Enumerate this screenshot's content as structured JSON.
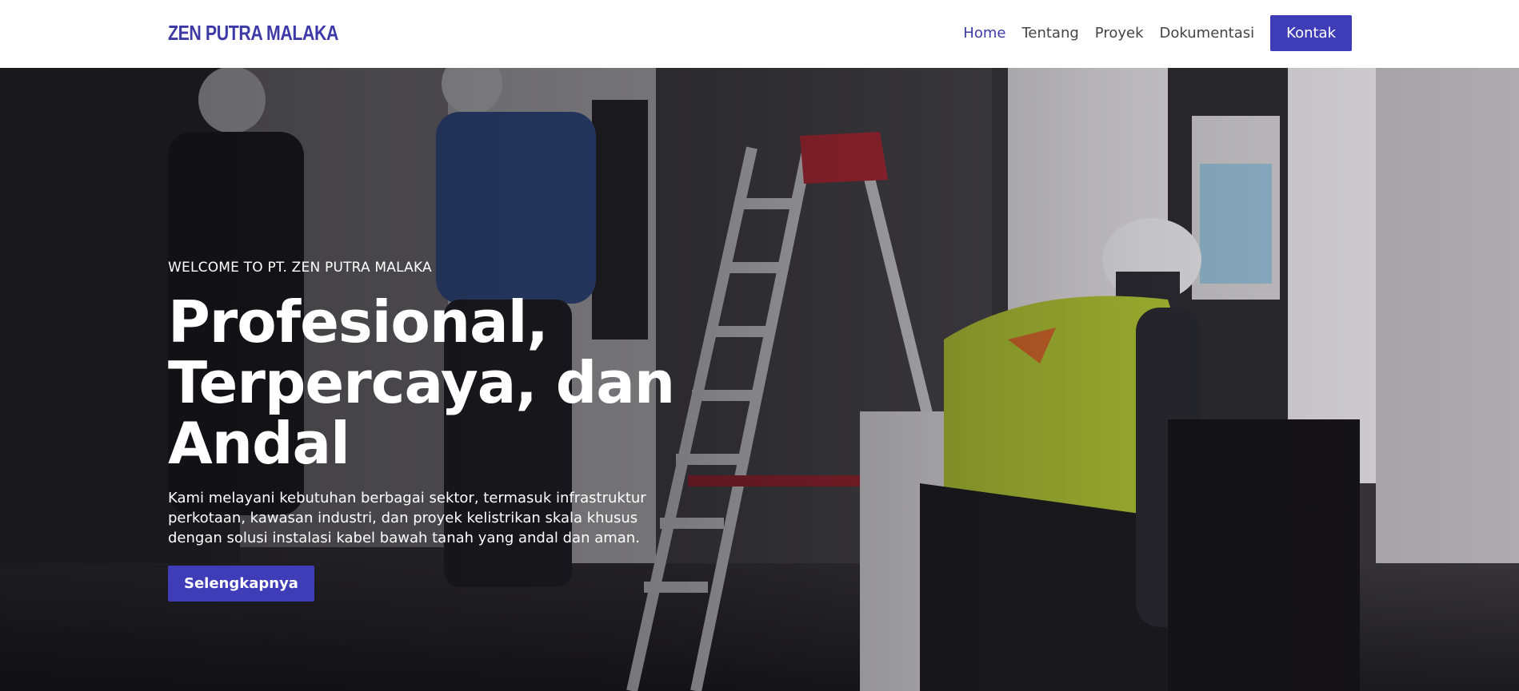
{
  "brand": {
    "name": "ZEN PUTRA MALAKA"
  },
  "nav": {
    "items": [
      {
        "label": "Home",
        "active": true
      },
      {
        "label": "Tentang",
        "active": false
      },
      {
        "label": "Proyek",
        "active": false
      },
      {
        "label": "Dokumentasi",
        "active": false
      }
    ],
    "cta_label": "Kontak"
  },
  "hero": {
    "eyebrow": "WELCOME TO PT. ZEN PUTRA MALAKA",
    "headline_lines": [
      "Profesional,",
      "Terpercaya, dan",
      "Andal"
    ],
    "description": "Kami melayani kebutuhan berbagai sektor, termasuk infrastruktur perkotaan, kawasan industri, dan proyek kelistrikan skala khusus dengan solusi instalasi kabel bawah tanah yang andal dan aman.",
    "button_label": "Selengkapnya",
    "image": "photo: electrical workers installing switchgear panels with a stepladder"
  },
  "colors": {
    "brand": "#3d3aa8",
    "button": "#3f3cb8",
    "nav_text": "#444444",
    "hero_text": "#ffffff"
  }
}
